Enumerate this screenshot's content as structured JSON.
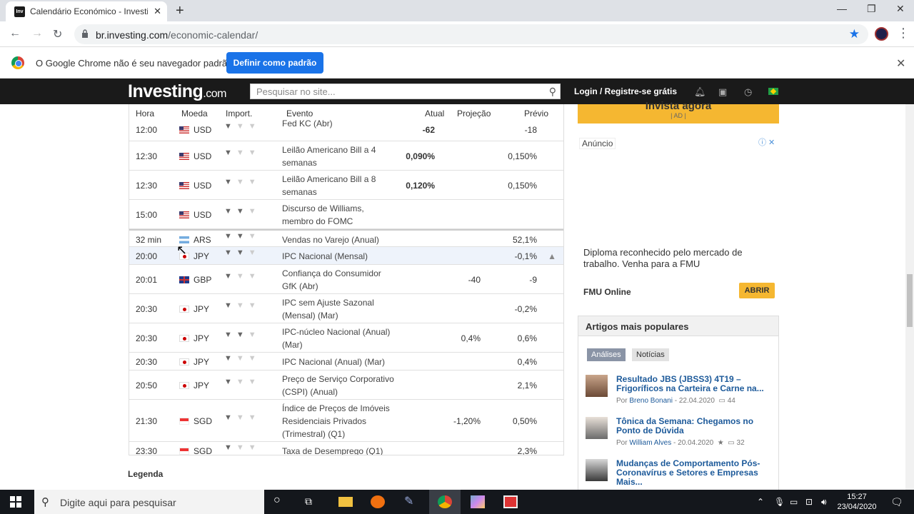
{
  "browser": {
    "tab_title": "Calendário Económico - Investing",
    "tab_favicon": "Inv",
    "url_domain": "br.investing.com",
    "url_path": "/economic-calendar/"
  },
  "infobar": {
    "message": "O Google Chrome não é seu navegador padrão",
    "button": "Definir como padrão"
  },
  "site": {
    "logo": "Investing",
    "logo_suffix": ".com",
    "search_placeholder": "Pesquisar no site...",
    "login": "Login / Registre-se grátis"
  },
  "calendar": {
    "headers": {
      "time": "Hora",
      "currency": "Moeda",
      "importance": "Import.",
      "event": "Evento",
      "actual": "Atual",
      "forecast": "Projeção",
      "previous": "Prévio"
    },
    "rows": [
      {
        "time": "12:00",
        "currency": "USD",
        "flag": "us",
        "bulls": 1,
        "event": "Fed KC (Abr)",
        "actual": "-62",
        "forecast": "",
        "previous": "-18"
      },
      {
        "time": "12:30",
        "currency": "USD",
        "flag": "us",
        "bulls": 1,
        "event": "Leilão Americano Bill a 4 semanas",
        "actual": "0,090%",
        "forecast": "",
        "previous": "0,150%"
      },
      {
        "time": "12:30",
        "currency": "USD",
        "flag": "us",
        "bulls": 1,
        "event": "Leilão Americano Bill a 8 semanas",
        "actual": "0,120%",
        "forecast": "",
        "previous": "0,150%"
      },
      {
        "time": "15:00",
        "currency": "USD",
        "flag": "us",
        "bulls": 2,
        "event": "Discurso de Williams, membro do FOMC",
        "actual": "",
        "forecast": "",
        "previous": ""
      },
      {
        "time": "32 min",
        "currency": "ARS",
        "flag": "ar",
        "bulls": 2,
        "event": "Vendas no Varejo (Anual)",
        "actual": "",
        "forecast": "",
        "previous": "52,1%"
      },
      {
        "time": "20:00",
        "currency": "JPY",
        "flag": "jp",
        "bulls": 2,
        "event": "IPC Nacional (Mensal)",
        "actual": "",
        "forecast": "",
        "previous": "-0,1%"
      },
      {
        "time": "20:01",
        "currency": "GBP",
        "flag": "gb",
        "bulls": 1,
        "event": "Confiança do Consumidor GfK (Abr)",
        "actual": "",
        "forecast": "-40",
        "previous": "-9"
      },
      {
        "time": "20:30",
        "currency": "JPY",
        "flag": "jp",
        "bulls": 1,
        "event": "IPC sem Ajuste Sazonal (Mensal) (Mar)",
        "actual": "",
        "forecast": "",
        "previous": "-0,2%"
      },
      {
        "time": "20:30",
        "currency": "JPY",
        "flag": "jp",
        "bulls": 2,
        "event": "IPC-núcleo Nacional (Anual) (Mar)",
        "actual": "",
        "forecast": "0,4%",
        "previous": "0,6%"
      },
      {
        "time": "20:30",
        "currency": "JPY",
        "flag": "jp",
        "bulls": 1,
        "event": "IPC Nacional (Anual) (Mar)",
        "actual": "",
        "forecast": "",
        "previous": "0,4%"
      },
      {
        "time": "20:50",
        "currency": "JPY",
        "flag": "jp",
        "bulls": 1,
        "event": "Preço de Serviço Corporativo (CSPI) (Anual)",
        "actual": "",
        "forecast": "",
        "previous": "2,1%"
      },
      {
        "time": "21:30",
        "currency": "SGD",
        "flag": "sg",
        "bulls": 1,
        "event": "Índice de Preços de Imóveis Residenciais Privados (Trimestral) (Q1)",
        "actual": "",
        "forecast": "-1,20%",
        "previous": "0,50%"
      },
      {
        "time": "23:30",
        "currency": "SGD",
        "flag": "sg",
        "bulls": 1,
        "event": "Taxa de Desemprego (Q1)",
        "actual": "",
        "forecast": "",
        "previous": "2,3%"
      }
    ],
    "legend": "Legenda"
  },
  "sidebar": {
    "ad_title": "Invista agora",
    "ad_sub": "| AD |",
    "ad_label": "Anúncio",
    "ad_text": "Diploma reconhecido pelo mercado de trabalho. Venha para a FMU",
    "ad_brand": "FMU Online",
    "ad_button": "ABRIR",
    "popular_title": "Artigos mais populares",
    "tab_analyses": "Análises",
    "tab_news": "Notícias",
    "articles": [
      {
        "title": "Resultado JBS (JBSS3) 4T19 – Frigoríficos na Carteira e Carne na...",
        "author_prefix": "Por",
        "author": "Breno Bonani",
        "date": "- 22.04.2020",
        "comments": "44"
      },
      {
        "title": "Tônica da Semana: Chegamos no Ponto de Dúvida",
        "author_prefix": "Por",
        "author": "William Alves",
        "date": "- 20.04.2020",
        "comments": "32"
      },
      {
        "title": "Mudanças de Comportamento Pós-Coronavírus e Setores e Empresas Mais...",
        "author_prefix": "",
        "author": "",
        "date": "",
        "comments": ""
      }
    ]
  },
  "taskbar": {
    "search_placeholder": "Digite aqui para pesquisar",
    "time": "15:27",
    "date": "23/04/2020"
  }
}
